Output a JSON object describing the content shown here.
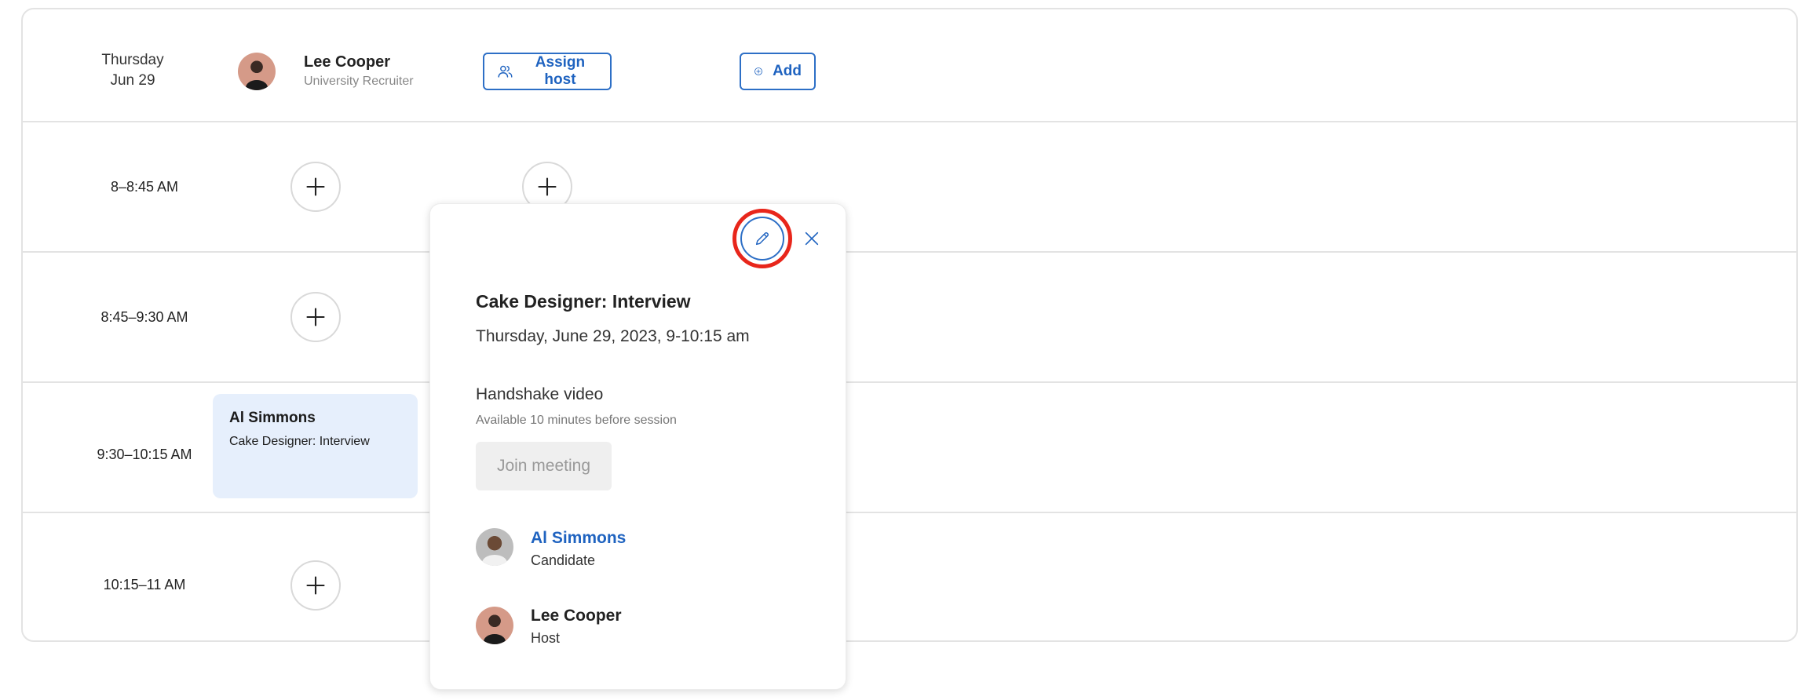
{
  "header": {
    "day": "Thursday",
    "date": "Jun 29",
    "host_name": "Lee Cooper",
    "host_role": "University Recruiter",
    "assign_host_label": "Assign host",
    "add_label": "Add"
  },
  "slots": [
    {
      "time": "8–8:45 AM"
    },
    {
      "time": "8:45–9:30 AM"
    },
    {
      "time": "9:30–10:15 AM"
    },
    {
      "time": "10:15–11 AM"
    }
  ],
  "event": {
    "name": "Al Simmons",
    "title": "Cake Designer: Interview"
  },
  "popover": {
    "title": "Cake Designer: Interview",
    "datetime": "Thursday, June 29, 2023, 9-10:15 am",
    "video_label": "Handshake video",
    "availability": "Available 10 minutes before session",
    "join_label": "Join meeting",
    "participants": [
      {
        "name": "Al Simmons",
        "role": "Candidate"
      },
      {
        "name": "Lee Cooper",
        "role": "Host"
      }
    ]
  },
  "colors": {
    "accent": "#1f63c0",
    "highlight": "#e8261b",
    "event_bg": "#e6effc"
  }
}
